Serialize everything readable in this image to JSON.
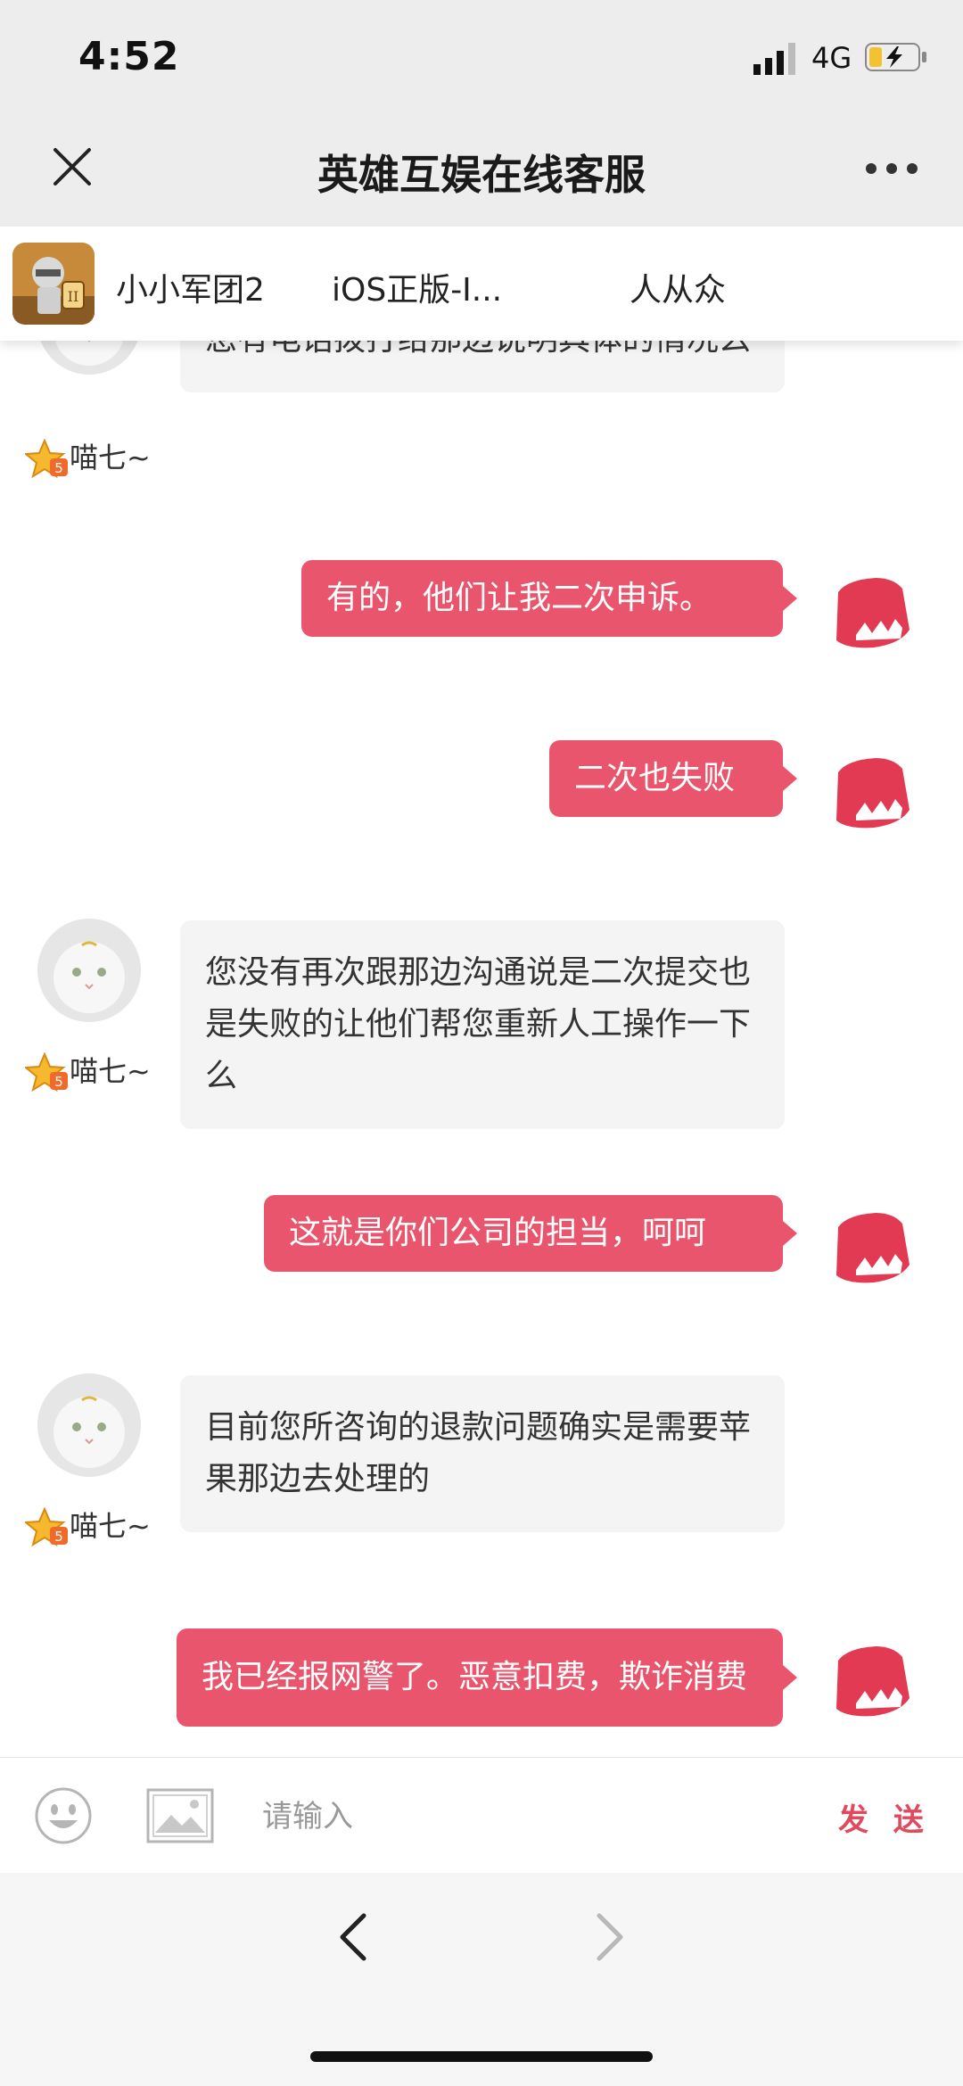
{
  "status": {
    "time": "4:52",
    "network": "4G"
  },
  "nav": {
    "title": "英雄互娱在线客服"
  },
  "game": {
    "name": "小小军团2",
    "platform": "iOS正版-I...",
    "publisher": "人从众"
  },
  "agent": {
    "name": "喵七~"
  },
  "messages": [
    {
      "from": "agent",
      "text": "您有电话拨打给那边说明具体的情况么"
    },
    {
      "from": "user",
      "text": "有的，他们让我二次申诉。"
    },
    {
      "from": "user",
      "text": "二次也失败"
    },
    {
      "from": "agent",
      "text": "您没有再次跟那边沟通说是二次提交也是失败的让他们帮您重新人工操作一下么"
    },
    {
      "from": "user",
      "text": "这就是你们公司的担当，呵呵"
    },
    {
      "from": "agent",
      "text": "目前您所咨询的退款问题确实是需要苹果那边去处理的"
    },
    {
      "from": "user",
      "text": "我已经报网警了。恶意扣费，欺诈消费"
    }
  ],
  "input": {
    "placeholder": "请输入",
    "send_label": "发 送"
  },
  "icons": {
    "close": "close-icon",
    "more": "more-icon",
    "emoji": "emoji-icon",
    "image": "image-icon",
    "back": "chevron-left-icon",
    "forward": "chevron-right-icon"
  },
  "colors": {
    "user_bubble": "#e8556c",
    "agent_bubble": "#f4f4f4",
    "send": "#e04a5e"
  }
}
